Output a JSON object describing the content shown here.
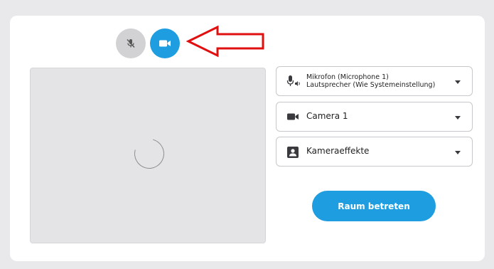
{
  "controls": {
    "mic_icon": "mic-off-icon",
    "camera_icon": "video-camera-icon",
    "camera_active_color": "#1e9ee0",
    "mic_inactive_color": "#d2d2d5"
  },
  "annotation": {
    "arrow_color": "#e01010"
  },
  "audio_select": {
    "icon": "mic-speaker-icon",
    "microphone": "Mikrofon (Microphone 1)",
    "speaker": "Lautsprecher (Wie Systemeinstellung)"
  },
  "camera_select": {
    "icon": "video-camera-icon",
    "value": "Camera 1"
  },
  "effects_select": {
    "icon": "portrait-icon",
    "value": "Kameraeffekte"
  },
  "join": {
    "label": "Raum betreten"
  }
}
